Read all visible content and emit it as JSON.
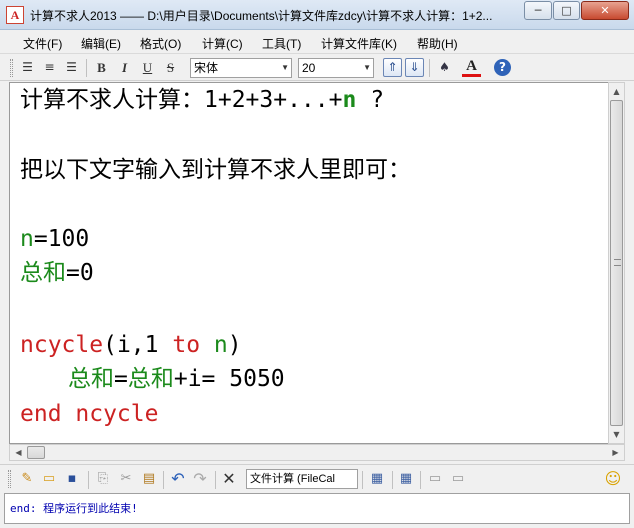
{
  "window": {
    "title": "计算不求人2013 —— D:\\用户目录\\Documents\\计算文件库zdcy\\计算不求人计算：1+2...",
    "icon_letter": "A",
    "controls": {
      "minimize": "─",
      "maximize": "□",
      "close": "✕"
    }
  },
  "menu": [
    {
      "label": "文件(F)"
    },
    {
      "label": "编辑(E)"
    },
    {
      "label": "格式(O)"
    },
    {
      "label": "计算(C)"
    },
    {
      "label": "工具(T)"
    },
    {
      "label": "计算文件库(K)"
    },
    {
      "label": "帮助(H)"
    }
  ],
  "format_toolbar": {
    "align_left_glyph": "☰",
    "align_center_glyph": "≡",
    "align_right_glyph": "☰",
    "bold": "B",
    "italic": "I",
    "underline": "U",
    "strike": "S",
    "font_name": "宋体",
    "font_size": "20",
    "up_glyph": "⇑",
    "down_glyph": "⇓",
    "find_glyph": "♠",
    "color_letter": "A",
    "help_glyph": "?",
    "font_color": "#d11"
  },
  "editor": {
    "line1_text": "计算不求人计算：1+2+3+...+",
    "line1_var": "n",
    "line1_tail": " ?",
    "line2": "把以下文字输入到计算不求人里即可：",
    "line3_var": "n",
    "line3_rest": "=100",
    "line4_var": "总和",
    "line4_rest": "=0",
    "line5_kw": "ncycle",
    "line5_open": "(i,1 ",
    "line5_to": "to",
    "line5_n": " n",
    "line5_close": ")",
    "line6_lhs": "总和",
    "line6_eq": "=",
    "line6_rhs": "总和",
    "line6_rest": "+i= 5050",
    "line7": "end ncycle"
  },
  "bottom_toolbar": {
    "new_glyph": "✎",
    "open_glyph": "▭",
    "save_glyph": "▪",
    "copy_glyph": "⎘",
    "cut_glyph": "✂",
    "paste_glyph": "▤",
    "undo_glyph": "↶",
    "redo_glyph": "↷",
    "delete_glyph": "✕",
    "file_mode": "文件计算 (FileCal",
    "calc_glyph": "▦",
    "table_glyph": "▦",
    "print_glyph": "▭",
    "preview_glyph": "▭",
    "smile_glyph": "☺"
  },
  "status": {
    "text": "end: 程序运行到此结束!"
  },
  "colors": {
    "var_green": "#1b8a1b",
    "keyword_red": "#d11",
    "status_blue": "#0000b0"
  },
  "scrollbars": {
    "vertical_up": "▲",
    "vertical_down": "▼",
    "horizontal_left": "◀",
    "horizontal_right": "▶"
  }
}
